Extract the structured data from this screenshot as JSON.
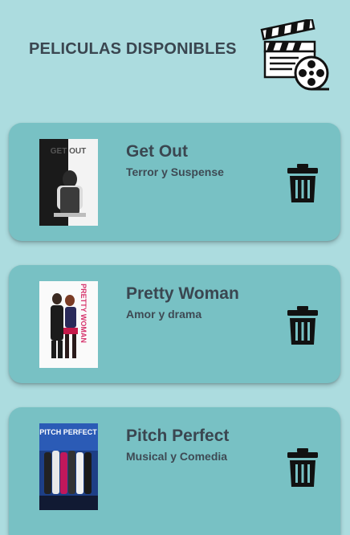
{
  "header": {
    "title": "PELICULAS DISPONIBLES",
    "icon": "movie-clapperboard-film-reel-icon"
  },
  "movies": [
    {
      "title": "Get Out",
      "genre": "Terror y Suspense",
      "poster_text": "GET OUT"
    },
    {
      "title": "Pretty Woman",
      "genre": "Amor y drama",
      "poster_text": "PRETTY WOMAN"
    },
    {
      "title": "Pitch Perfect",
      "genre": "Musical y Comedia",
      "poster_text": "PITCH PERFECT"
    }
  ],
  "colors": {
    "background": "#acdcdf",
    "card": "#78c1c4",
    "text": "#3a4650",
    "icon": "#111111"
  }
}
